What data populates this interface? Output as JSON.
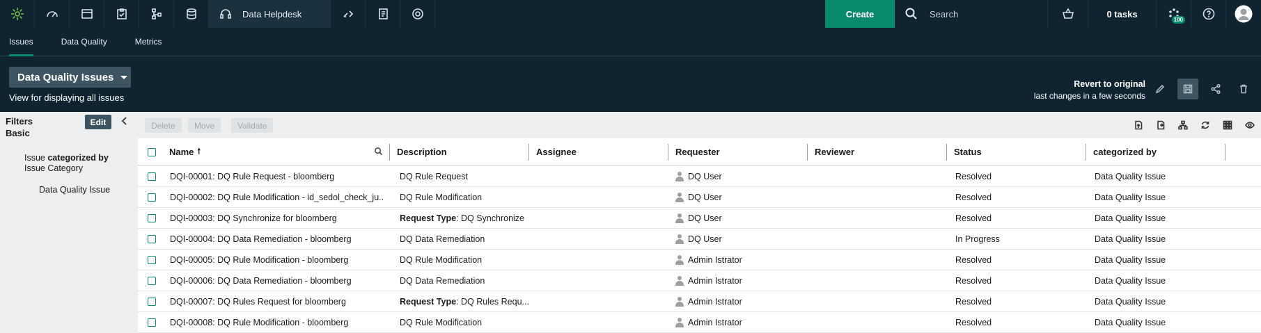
{
  "topbar": {
    "app_title": "Data Helpdesk",
    "create_label": "Create",
    "search_placeholder": "Search",
    "tasks_label": "0 tasks",
    "notification_count": "100",
    "icons": [
      "logo-icon",
      "dashboard-icon",
      "folder-icon",
      "clipboard-icon",
      "hierarchy-icon",
      "database-icon",
      "headset-icon",
      "transfer-icon",
      "report-icon",
      "gear-icon",
      "basket-icon",
      "notification-icon",
      "help-icon",
      "avatar-icon"
    ]
  },
  "subtabs": [
    "Issues",
    "Data Quality",
    "Metrics"
  ],
  "view": {
    "title": "Data Quality Issues",
    "description": "View for displaying all issues",
    "revert_title": "Revert to original",
    "revert_sub": "last changes in a few seconds"
  },
  "filters": {
    "title": "Filters",
    "mode": "Basic",
    "edit_label": "Edit",
    "group_prefix": "Issue ",
    "group_bold": "categorized by",
    "group_suffix": "Issue Category",
    "value": "Data Quality Issue"
  },
  "toolbar": {
    "delete_label": "Delete",
    "move_label": "Move",
    "validate_label": "Validate"
  },
  "columns": [
    "Name",
    "Description",
    "Assignee",
    "Requester",
    "Reviewer",
    "Status",
    "categorized by"
  ],
  "rows": [
    {
      "name": "DQI-00001: DQ Rule Request - bloomberg",
      "desc_label": "",
      "desc": "DQ Rule Request",
      "requester": "DQ User",
      "status": "Resolved",
      "category": "Data Quality Issue"
    },
    {
      "name": "DQI-00002: DQ Rule Modification - id_sedol_check_ju...",
      "desc_label": "",
      "desc": "DQ Rule Modification",
      "requester": "DQ User",
      "status": "Resolved",
      "category": "Data Quality Issue"
    },
    {
      "name": "DQI-00003: DQ Synchronize for bloomberg",
      "desc_label": "Request Type",
      "desc": ": DQ Synchronize",
      "requester": "DQ User",
      "status": "Resolved",
      "category": "Data Quality Issue"
    },
    {
      "name": "DQI-00004: DQ Data Remediation - bloomberg",
      "desc_label": "",
      "desc": "DQ Data Remediation",
      "requester": "DQ User",
      "status": "In Progress",
      "category": "Data Quality Issue"
    },
    {
      "name": "DQI-00005: DQ Rule Modification - bloomberg",
      "desc_label": "",
      "desc": "DQ Rule Modification",
      "requester": "Admin Istrator",
      "status": "Resolved",
      "category": "Data Quality Issue"
    },
    {
      "name": "DQI-00006: DQ Data Remediation - bloomberg",
      "desc_label": "",
      "desc": "DQ Data Remediation",
      "requester": "Admin Istrator",
      "status": "Resolved",
      "category": "Data Quality Issue"
    },
    {
      "name": "DQI-00007: DQ Rules Request for bloomberg",
      "desc_label": "Request Type",
      "desc": ": DQ Rules Requ...",
      "requester": "Admin Istrator",
      "status": "Resolved",
      "category": "Data Quality Issue"
    },
    {
      "name": "DQI-00008: DQ Rule Modification - bloomberg",
      "desc_label": "",
      "desc": "DQ Rule Modification",
      "requester": "Admin Istrator",
      "status": "Resolved",
      "category": "Data Quality Issue"
    }
  ],
  "colors": {
    "nav_bg": "#0f2330",
    "accent": "#0a8a6c",
    "panel_bg": "#eceeef"
  }
}
